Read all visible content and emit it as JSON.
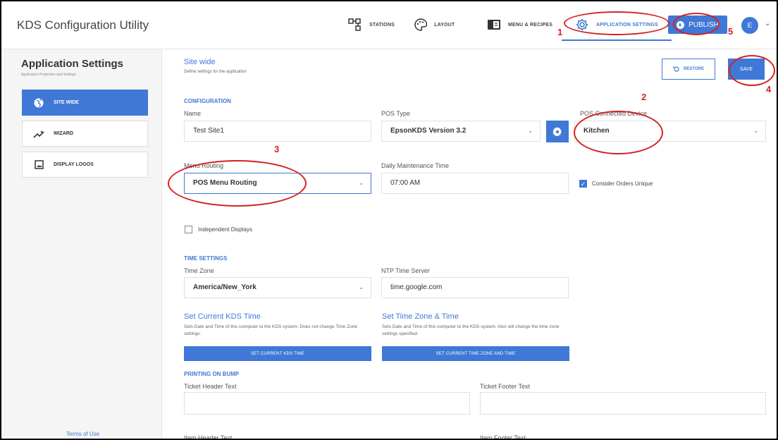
{
  "header": {
    "app_title": "KDS Configuration Utility",
    "nav": [
      {
        "label": "STATIONS",
        "icon": "stations-icon"
      },
      {
        "label": "LAYOUT",
        "icon": "palette-icon"
      },
      {
        "label": "MENU & RECIPES",
        "icon": "book-icon"
      },
      {
        "label": "APPLICATION SETTINGS",
        "icon": "gear-icon",
        "active": true
      }
    ],
    "publish_label": "PUBLISH",
    "avatar_initial": "E",
    "accent_color": "#3f78d6"
  },
  "sidebar": {
    "title": "Application Settings",
    "subtitle": "Application Properties and Settings",
    "items": [
      {
        "label": "SITE WIDE",
        "icon": "globe-icon",
        "active": true
      },
      {
        "label": "WIZARD",
        "icon": "wand-icon"
      },
      {
        "label": "DISPLAY LOGOS",
        "icon": "image-icon"
      }
    ],
    "terms_label": "Terms of Use"
  },
  "main": {
    "section_title": "Site wide",
    "section_desc": "Define settings for the application",
    "restore_label": "RESTORE",
    "save_label": "SAVE",
    "configuration": {
      "heading": "CONFIGURATION",
      "name_label": "Name",
      "name_value": "Test Site1",
      "pos_type_label": "POS Type",
      "pos_type_value": "EpsonKDS Version 3.2",
      "pos_device_label": "POS Connected Device",
      "pos_device_value": "Kitchen",
      "menu_routing_label": "Menu Routing",
      "menu_routing_value": "POS Menu Routing",
      "daily_maint_label": "Daily Maintenance Time",
      "daily_maint_value": "07:00 AM",
      "consider_unique_label": "Consider Orders Unique",
      "consider_unique_checked": true,
      "independent_label": "Independent Displays",
      "independent_checked": false
    },
    "time_settings": {
      "heading": "TIME SETTINGS",
      "time_zone_label": "Time Zone",
      "time_zone_value": "America/New_York",
      "ntp_label": "NTP Time Server",
      "ntp_value": "time.google.com",
      "set_kds_title": "Set Current KDS Time",
      "set_kds_desc": "Sets Date and Time of this computer to the KDS system. Does not change Time Zone settings.",
      "set_kds_button": "SET CURRENT KDS TIME",
      "set_tz_title": "Set Time Zone & Time",
      "set_tz_desc": "Sets Date and Time of this computer to the KDS system. Also will change the time zone settings specified.",
      "set_tz_button": "SET CURRENT TIME ZONE AND TIME"
    },
    "printing": {
      "heading": "PRINTING ON BUMP",
      "ticket_header_label": "Ticket Header Text",
      "ticket_footer_label": "Ticket Footer Text",
      "item_header_label": "Item Header Text",
      "item_footer_label": "Item Footer Text"
    }
  },
  "annotations": {
    "numbers": [
      "1",
      "2",
      "3",
      "4",
      "5"
    ],
    "color": "#d42222"
  }
}
